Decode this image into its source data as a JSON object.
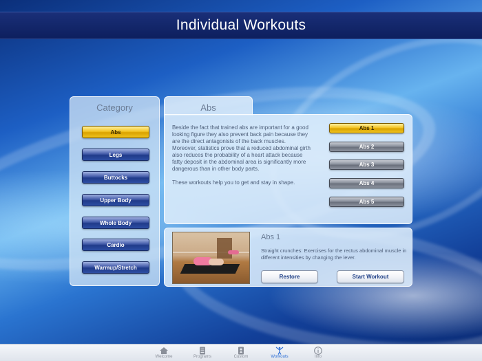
{
  "header": {
    "title": "Individual Workouts"
  },
  "category": {
    "title": "Category",
    "items": [
      {
        "label": "Abs",
        "active": true
      },
      {
        "label": "Legs",
        "active": false
      },
      {
        "label": "Buttocks",
        "active": false
      },
      {
        "label": "Upper Body",
        "active": false
      },
      {
        "label": "Whole Body",
        "active": false
      },
      {
        "label": "Cardio",
        "active": false
      },
      {
        "label": "Warmup/Stretch",
        "active": false
      }
    ]
  },
  "tab": {
    "label": "Abs"
  },
  "description": {
    "paragraph1": "Beside the fact that trained abs are important for a good looking figure they also prevent back pain because they are the direct antagonists of the back muscles.",
    "paragraph2": "Moreover, statistics prove that a reduced abdominal girth also reduces the probability of a heart attack because fatty deposit in the abdominal area is significantly more dangerous than in other body parts.",
    "paragraph3": "These workouts help you to get and stay in shape."
  },
  "workouts": [
    {
      "label": "Abs 1",
      "active": true
    },
    {
      "label": "Abs 2",
      "active": false
    },
    {
      "label": "Abs 3",
      "active": false
    },
    {
      "label": "Abs 4",
      "active": false
    },
    {
      "label": "Abs 5",
      "active": false
    }
  ],
  "detail": {
    "title": "Abs 1",
    "text": "Straight crunches: Exercises for the rectus abdominal muscle in different intensities by changing the lever.",
    "restore_label": "Restore",
    "start_label": "Start Workout"
  },
  "tabbar": {
    "items": [
      {
        "label": "Welcome",
        "icon": "house-icon",
        "active": false
      },
      {
        "label": "Programs",
        "icon": "document-icon",
        "active": false
      },
      {
        "label": "Custom",
        "icon": "custom-figure-icon",
        "active": false
      },
      {
        "label": "Workouts",
        "icon": "person-stretch-icon",
        "active": true
      },
      {
        "label": "Info",
        "icon": "info-icon",
        "active": false
      }
    ]
  },
  "colors": {
    "accent_gold": "#f2c424",
    "header_navy": "#0d1f5e",
    "category_blue": "#203b8a",
    "tab_active": "#2d6fd6"
  }
}
